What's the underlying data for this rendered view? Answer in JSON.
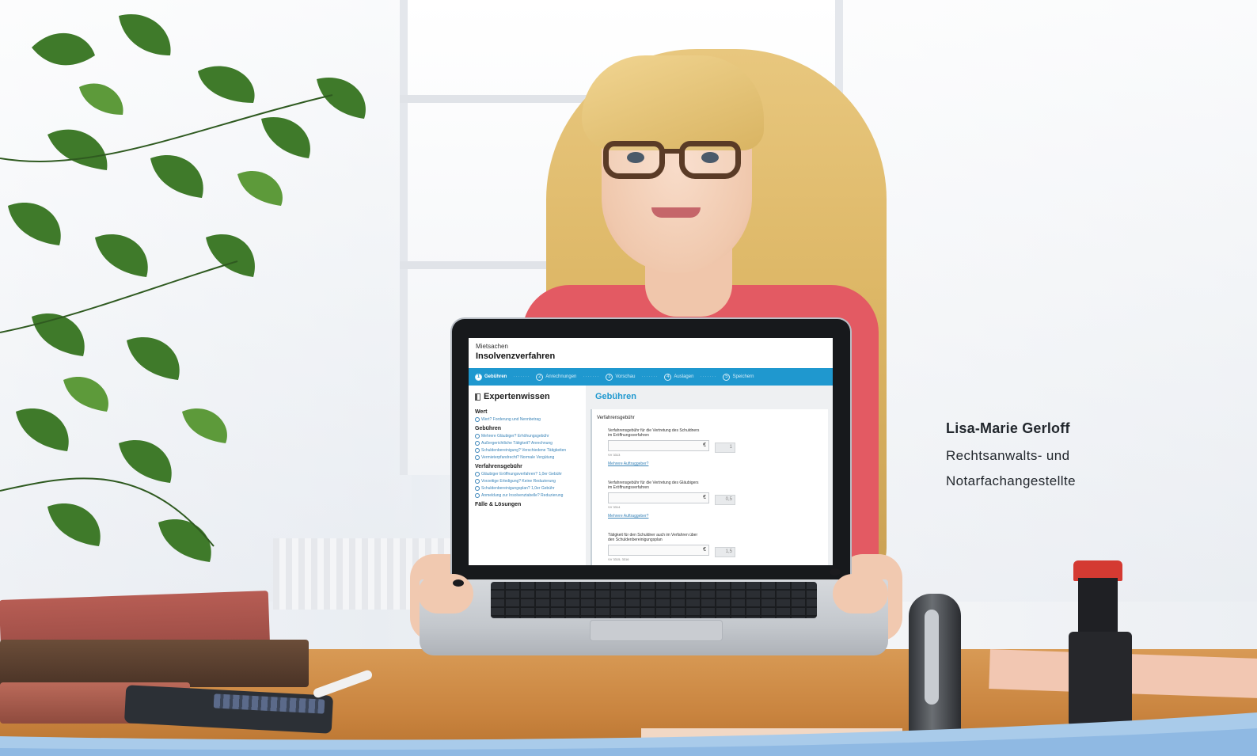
{
  "caption": {
    "name": "Lisa-Marie Gerloff",
    "role_line1": "Rechtsanwalts- und",
    "role_line2": "Notarfachangestellte"
  },
  "screen_app": {
    "breadcrumb": "Mietsachen",
    "title": "Insolvenzverfahren",
    "steps": [
      {
        "num": "1",
        "label": "Gebühren",
        "active": true
      },
      {
        "num": "2",
        "label": "Anrechnungen",
        "active": false
      },
      {
        "num": "3",
        "label": "Vorschau",
        "active": false
      },
      {
        "num": "4",
        "label": "Auslagen",
        "active": false
      },
      {
        "num": "5",
        "label": "Speichern",
        "active": false
      }
    ],
    "sidebar": {
      "title": "Expertenwissen",
      "sections": [
        {
          "heading": "Wert",
          "items": [
            "Wert? Forderung und Nennbetrag"
          ]
        },
        {
          "heading": "Gebühren",
          "items": [
            "Mehrere Gläubiger? Erhöhungsgebühr",
            "Außergerichtliche Tätigkeit? Anrechnung",
            "Schuldenbereinigung? Verschiedene Tätigkeiten",
            "Vermieterpfandrecht? Normale Vergütung"
          ]
        },
        {
          "heading": "Verfahrensgebühr",
          "items": [
            "Gläubiger Eröffnungsverfahren? 1,0er Gebühr",
            "Vorzeitige Erledigung? Keine Reduzierung",
            "Schuldenbereinigungsplan? 1,0er Gebühr",
            "Anmeldung zur Insolvenztabelle? Reduzierung"
          ]
        },
        {
          "heading": "Fälle & Lösungen",
          "items": []
        }
      ]
    },
    "main": {
      "title": "Gebühren",
      "panel_heading": "Verfahrensgebühr",
      "fields": [
        {
          "label": "Verfahrensgebühr für die Vertretung des Schuldners im Eröffnungsverfahren",
          "currency": "€",
          "factor": "1",
          "sub": "VV 3313",
          "link": "Mehrere Auftraggeber?"
        },
        {
          "label": "Verfahrensgebühr für die Vertretung des Gläubigers im Eröffnungsverfahren",
          "currency": "€",
          "factor": "0,5",
          "sub": "VV 3314",
          "link": "Mehrere Auftraggeber?"
        },
        {
          "label": "Tätigkeit für den Schuldner auch im Verfahren über den Schuldenbereinigungsplan",
          "currency": "€",
          "factor": "1,5",
          "sub": "VV 3315, 3316",
          "link": ""
        }
      ]
    }
  },
  "colors": {
    "accent_blue": "#1f98cf",
    "shirt": "#e35a63",
    "desk": "#c9843f",
    "stamp_red": "#d43a32"
  }
}
